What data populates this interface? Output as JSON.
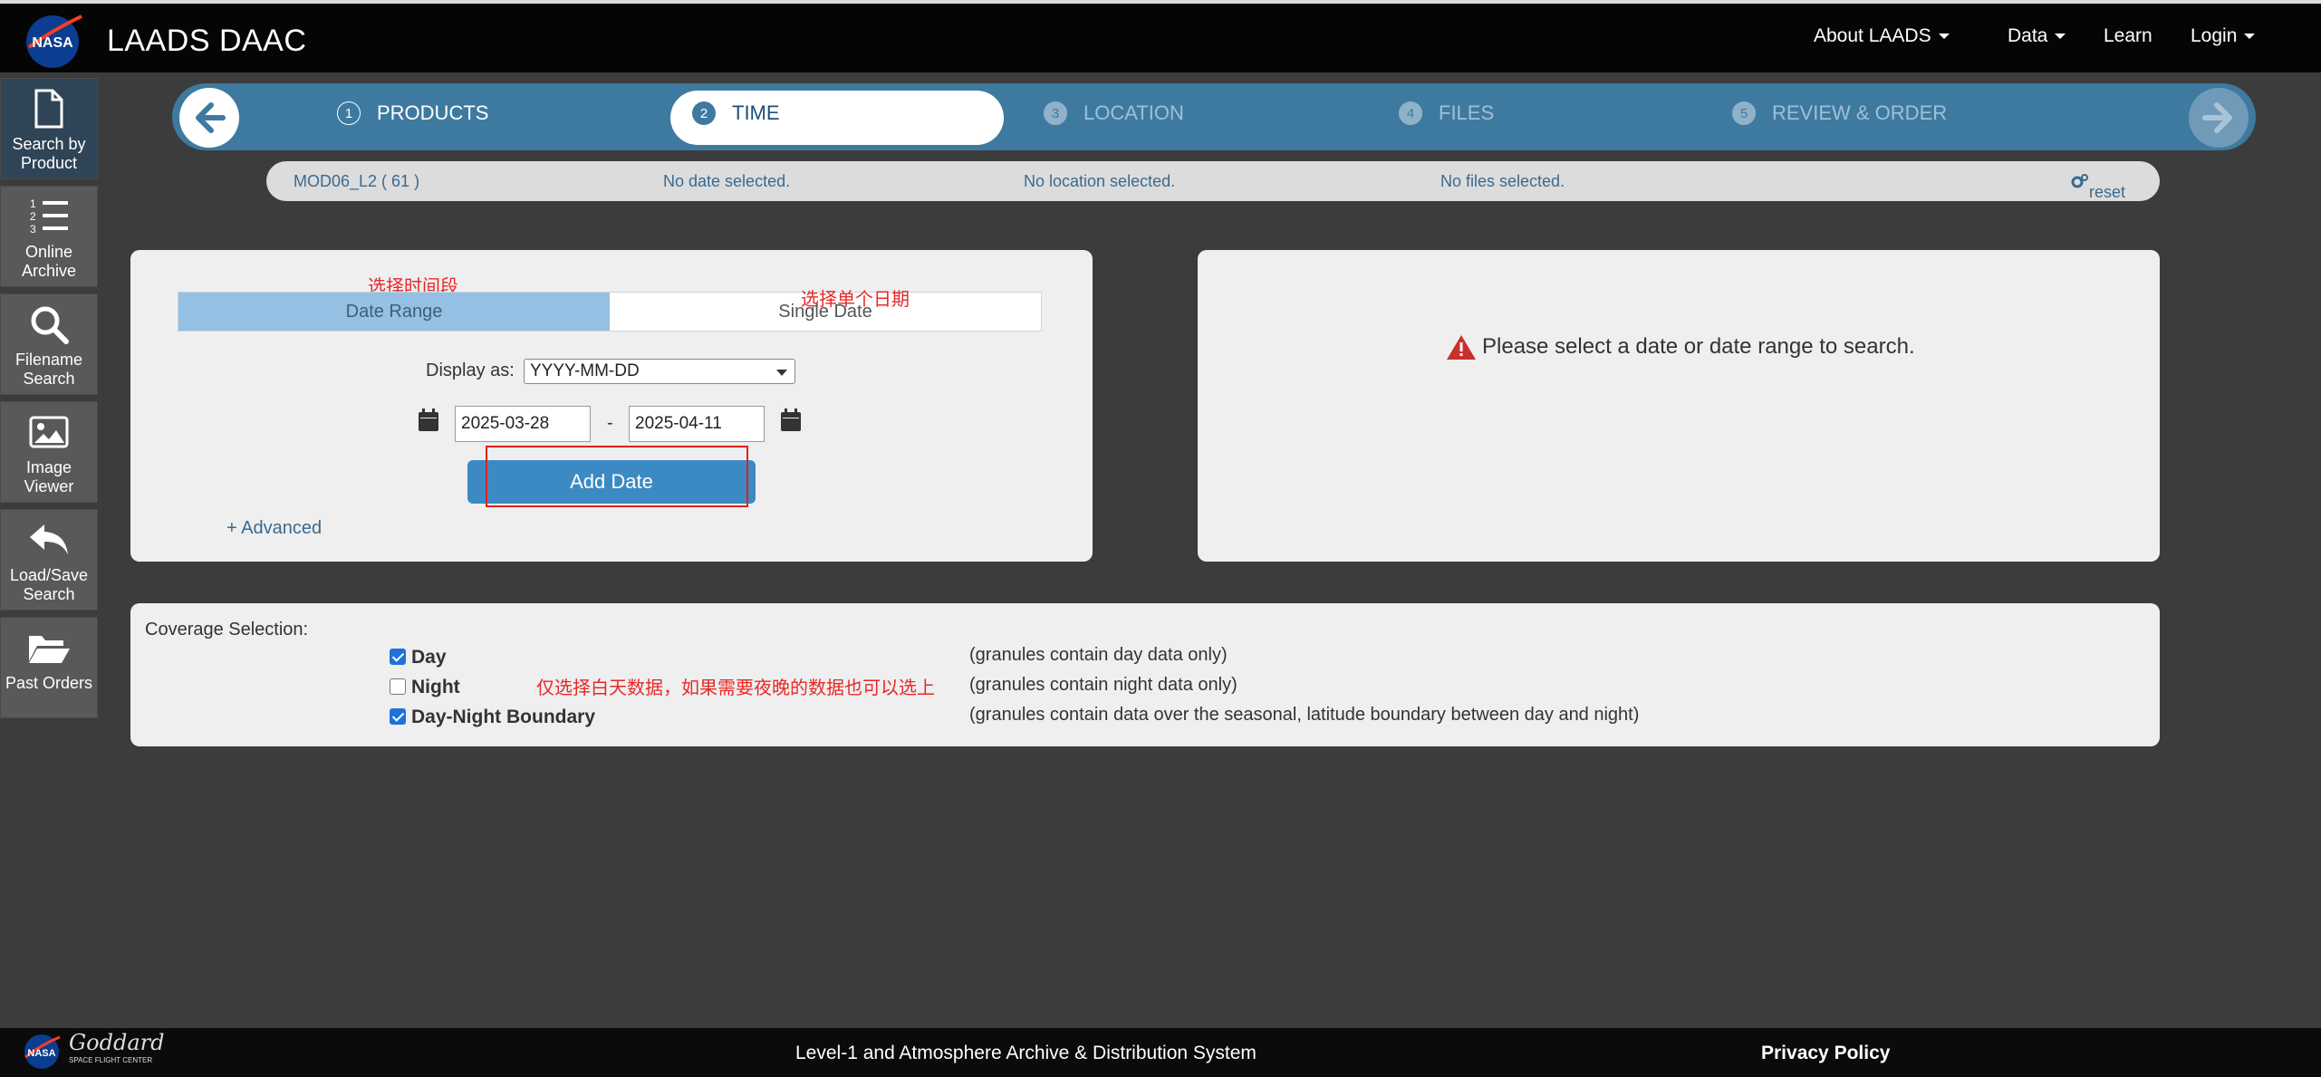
{
  "header": {
    "site_title": "LAADS DAAC",
    "nav": [
      "About LAADS",
      "Data",
      "Learn",
      "Login"
    ]
  },
  "sidebar": {
    "items": [
      {
        "label": "Search by Product",
        "icon": "file-icon"
      },
      {
        "label": "Online Archive",
        "icon": "list-icon"
      },
      {
        "label": "Filename Search",
        "icon": "search-icon"
      },
      {
        "label": "Image Viewer",
        "icon": "image-icon"
      },
      {
        "label": "Load/Save Search",
        "icon": "reply-icon"
      },
      {
        "label": "Past Orders",
        "icon": "folder-icon"
      }
    ]
  },
  "steps": [
    {
      "num": "1",
      "label": "PRODUCTS"
    },
    {
      "num": "2",
      "label": "TIME"
    },
    {
      "num": "3",
      "label": "LOCATION"
    },
    {
      "num": "4",
      "label": "FILES"
    },
    {
      "num": "5",
      "label": "REVIEW & ORDER"
    }
  ],
  "summary": {
    "product": "MOD06_L2 ( 61 )",
    "date": "No date selected.",
    "location": "No location selected.",
    "files": "No files selected.",
    "reset": "reset"
  },
  "date_panel": {
    "tab_range": "Date Range",
    "tab_single": "Single Date",
    "note_range": "选择时间段",
    "note_single": "选择单个日期",
    "display_label": "Display as:",
    "display_value": "YYYY-MM-DD",
    "start_date": "2025-03-28",
    "end_date": "2025-04-11",
    "separator": "-",
    "add_button": "Add Date",
    "advanced": "+ Advanced"
  },
  "result_panel": {
    "message": "Please select a date or date range to search."
  },
  "coverage": {
    "title": "Coverage Selection:",
    "note": "仅选择白天数据，如果需要夜晚的数据也可以选上",
    "options": [
      {
        "label": "Day",
        "checked": true,
        "desc": "(granules contain day data only)"
      },
      {
        "label": "Night",
        "checked": false,
        "desc": "(granules contain night data only)"
      },
      {
        "label": "Day-Night Boundary",
        "checked": true,
        "desc": "(granules contain data over the seasonal, latitude boundary between day and night)"
      }
    ]
  },
  "footer": {
    "center": "Level-1 and Atmosphere Archive & Distribution System",
    "privacy": "Privacy Policy",
    "goddard": "Goddard",
    "goddard_sub": "SPACE FLIGHT CENTER"
  },
  "colors": {
    "accent": "#3e7aa0",
    "button": "#3c8ac4",
    "annotation": "#e82828"
  }
}
